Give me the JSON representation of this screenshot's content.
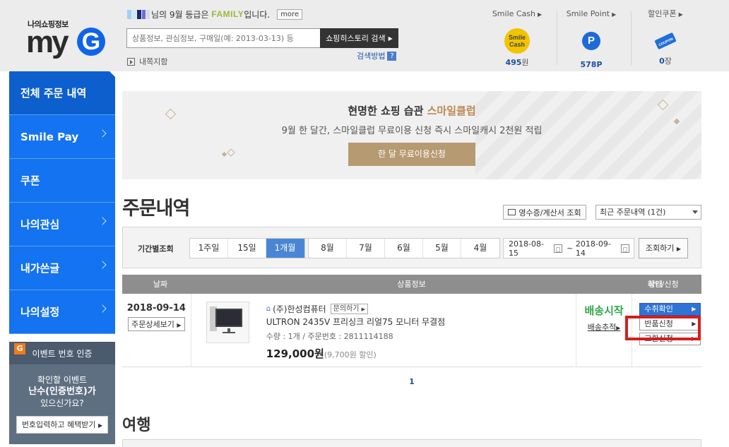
{
  "logo": {
    "sub": "나의쇼핑정보",
    "main": "my",
    "letter": "G"
  },
  "header": {
    "greeting_suffix": "님의 9월 등급은",
    "grade": "FAMILY",
    "greeting_end": "입니다.",
    "more": "more",
    "search_placeholder": "상품정보, 관심정보, 구매일(예: 2013-03-13) 등",
    "search_button": "쇼핑히스토리 검색",
    "search_help": "검색방법",
    "search_help_icon": "?",
    "mypicks": "내쪽지함"
  },
  "wallet": {
    "cash": {
      "label": "Smile Cash",
      "icon_line1": "Smile",
      "icon_line2": "Cash",
      "value": "495",
      "unit": "원"
    },
    "point": {
      "label": "Smile Point",
      "icon": "P",
      "value": "578",
      "unit": "P"
    },
    "coupon": {
      "label": "할인쿠폰",
      "icon_text": "COUPON",
      "value": "0",
      "unit": "장"
    }
  },
  "sidebar": {
    "items": [
      {
        "label": "전체 주문 내역"
      },
      {
        "label": "Smile Pay"
      },
      {
        "label": "쿠폰"
      },
      {
        "label": "나의관심"
      },
      {
        "label": "내가쓴글"
      },
      {
        "label": "나의설정"
      }
    ],
    "event": {
      "badge": "G",
      "title": "이벤트 번호 인증",
      "line1": "확인할 이벤트",
      "line2": "난수(인증번호)가",
      "line3": "있으신가요?",
      "button": "번호입력하고 혜택받기"
    }
  },
  "banner": {
    "title_prefix": "현명한 쇼핑 습관",
    "title_accent": "스마일클럽",
    "subtitle": "9월 한 달간, 스마일클럽 무료이용 신청 즉시 스마일캐시 2천원 적립",
    "cta": "한 달 무료이용신청"
  },
  "main": {
    "title": "주문내역",
    "receipt_button": "영수증/계산서 조회",
    "period_select": "최근 주문내역 (1건)"
  },
  "filter": {
    "label": "기간별조회",
    "periods": [
      "1주일",
      "15일",
      "1개월"
    ],
    "months": [
      "8월",
      "7월",
      "6월",
      "5월",
      "4월"
    ],
    "date_from": "2018-08-15",
    "date_sep": "~",
    "date_to": "2018-09-14",
    "search_button": "조회하기"
  },
  "table": {
    "headers": [
      "날짜",
      "상품정보",
      "상태",
      "확인/신청"
    ],
    "rows": [
      {
        "date": "2018-09-14",
        "detail_button": "주문상세보기",
        "seller": "(주)한성컴퓨터",
        "ask_button": "문의하기",
        "product": "ULTRON 2435V 프리싱크 리얼75 모니터 무결점",
        "meta": "수량 : 1개 / 주문번호 : 2811114188",
        "price": "129,000원",
        "discount": "(9,700원 할인)",
        "status": "배송시작",
        "tracking": "배송추적",
        "actions": [
          "수취확인",
          "반품신청",
          "교환신청"
        ]
      }
    ]
  },
  "pager": {
    "current": "1"
  },
  "section2": {
    "title": "여행"
  },
  "colors": {
    "sidebar": "#1473f0",
    "accent_gold": "#b59a72",
    "status_green": "#2fa84c",
    "highlight": "#d81c1c"
  }
}
